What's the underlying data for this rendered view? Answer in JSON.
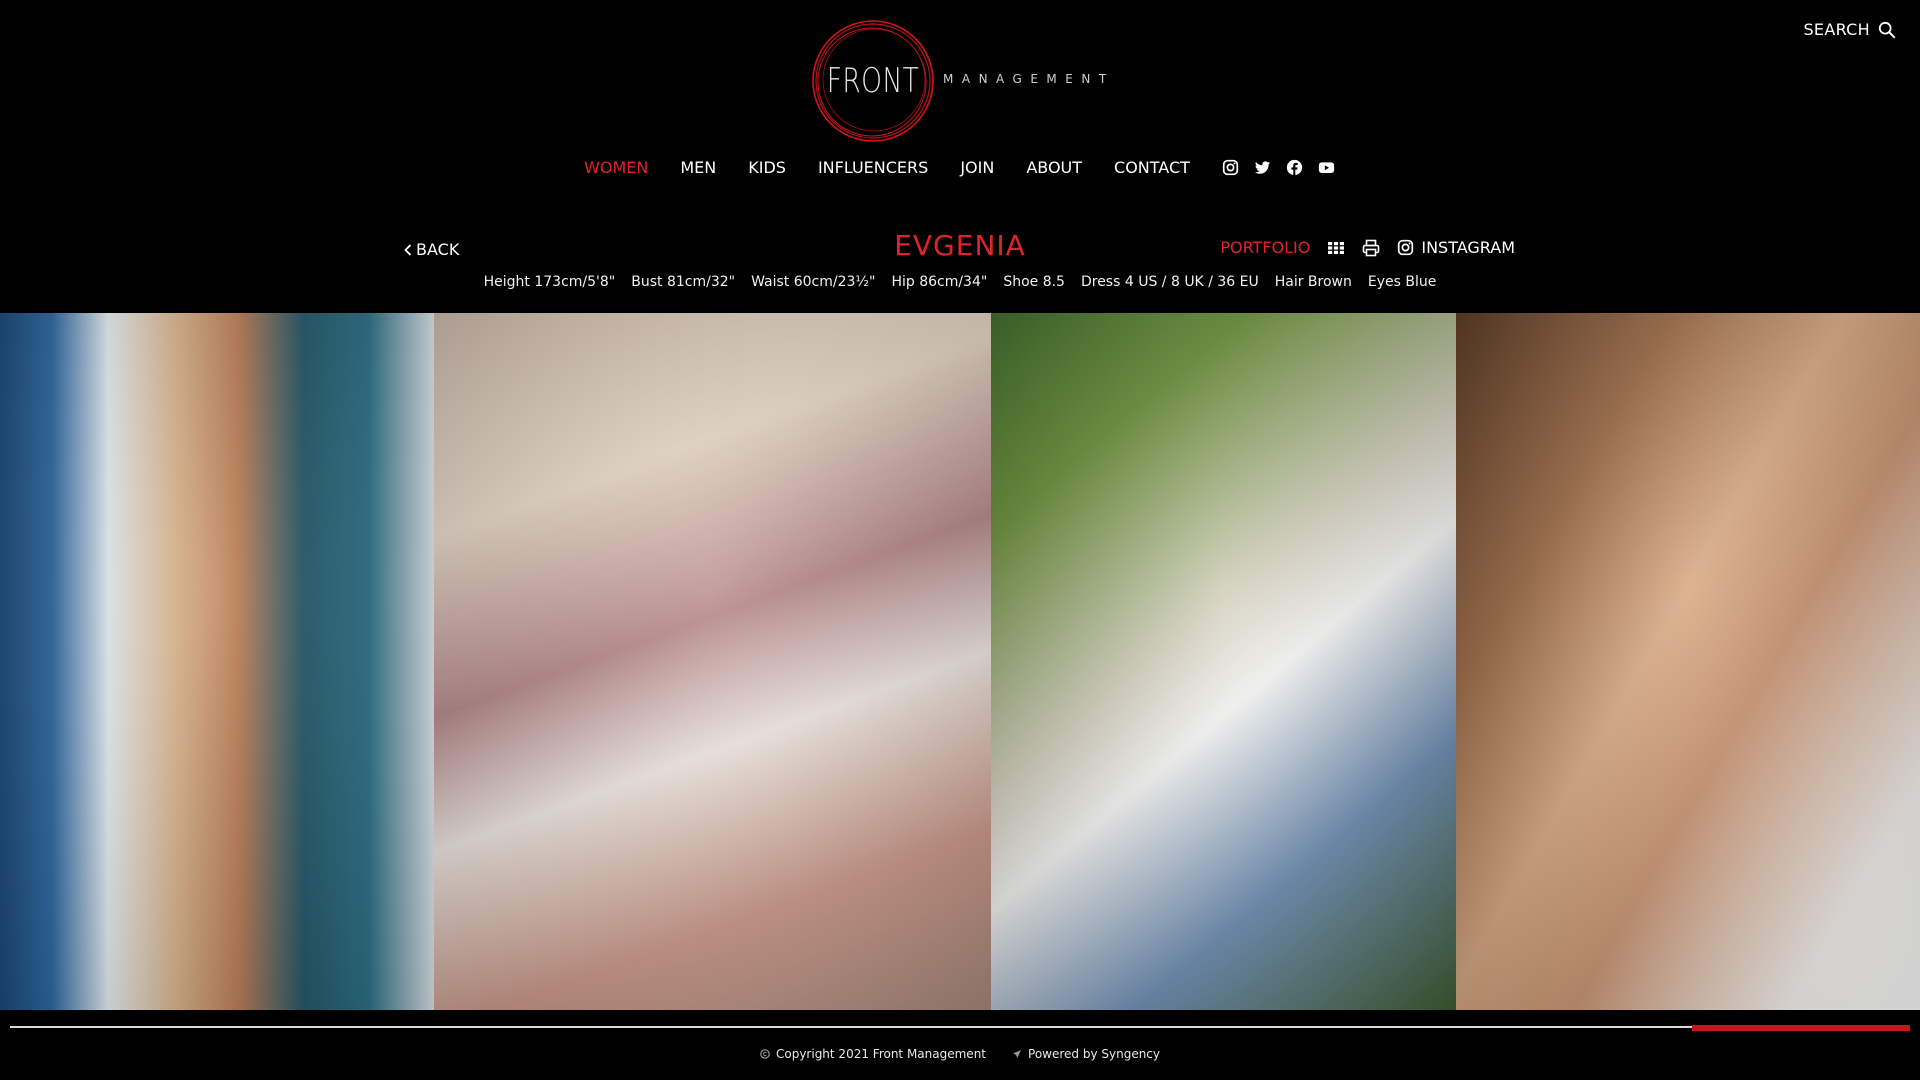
{
  "header": {
    "search_label": "SEARCH",
    "search_icon": "search-icon",
    "logo": {
      "word": "FRONT",
      "sub": "MANAGEMENT",
      "ring_color": "#d4141c"
    }
  },
  "nav": {
    "items": [
      {
        "label": "WOMEN",
        "active": true
      },
      {
        "label": "MEN",
        "active": false
      },
      {
        "label": "KIDS",
        "active": false
      },
      {
        "label": "INFLUENCERS",
        "active": false
      },
      {
        "label": "JOIN",
        "active": false
      },
      {
        "label": "ABOUT",
        "active": false
      },
      {
        "label": "CONTACT",
        "active": false
      }
    ],
    "socials": [
      "instagram-icon",
      "twitter-icon",
      "facebook-icon",
      "youtube-icon"
    ]
  },
  "model": {
    "back_label": "BACK",
    "name": "EVGENIA",
    "portfolio_label": "PORTFOLIO",
    "instagram_label": "INSTAGRAM",
    "stats": [
      "Height 173cm/5'8\"",
      "Bust 81cm/32\"",
      "Waist 60cm/23½\"",
      "Hip 86cm/34\"",
      "Shoe 8.5",
      "Dress 4 US / 8 UK / 36 EU",
      "Hair Brown",
      "Eyes Blue"
    ]
  },
  "gallery": {
    "photos": [
      "photo-blue-swimsuit",
      "photo-cafe-coconut",
      "photo-garden-white-tee",
      "photo-closeup-portrait"
    ],
    "scroll_progress": 0.115
  },
  "footer": {
    "copyright": "Copyright 2021 Front Management",
    "powered": "Powered by Syngency"
  },
  "colors": {
    "accent": "#e0232b",
    "background": "#000000"
  }
}
